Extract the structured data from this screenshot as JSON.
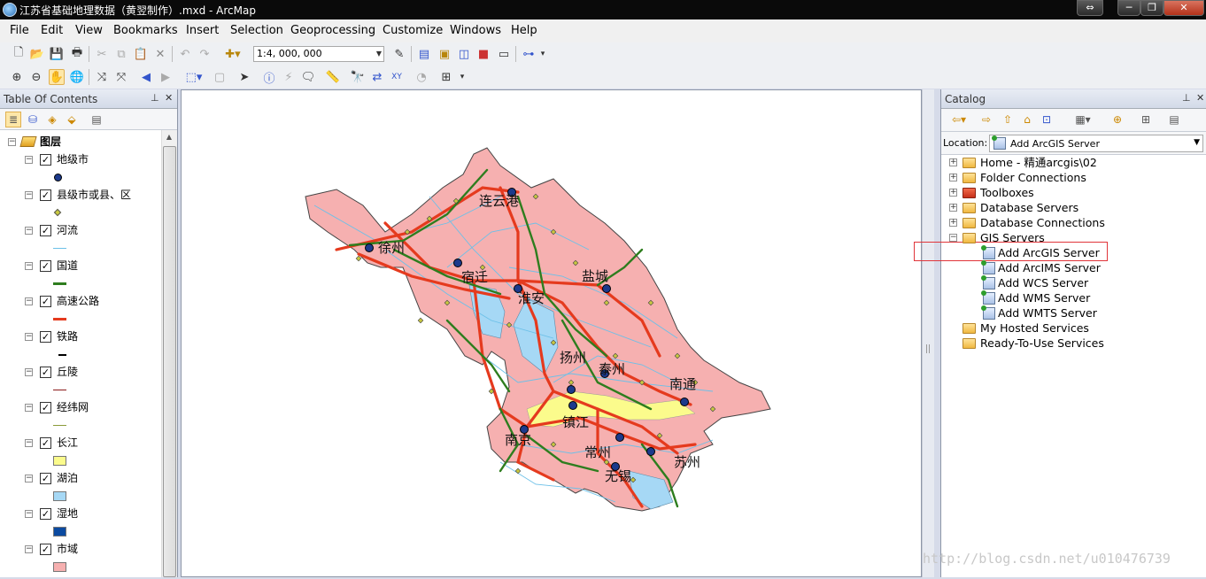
{
  "window": {
    "title": "江苏省基础地理数据（黄翌制作）.mxd - ArcMap",
    "controls": [
      "⇔",
      "─",
      "❐",
      "✕"
    ]
  },
  "menu": [
    "File",
    "Edit",
    "View",
    "Bookmarks",
    "Insert",
    "Selection",
    "Geoprocessing",
    "Customize",
    "Windows",
    "Help"
  ],
  "toolbar": {
    "scale": "1:4, 000, 000"
  },
  "toc": {
    "title": "Table Of Contents",
    "root": "图层",
    "layers": [
      {
        "name": "地级市",
        "symbol": "point-dark",
        "color": "#1c3a8c"
      },
      {
        "name": "县级市或县、区",
        "symbol": "point-small",
        "color": "#c8c840"
      },
      {
        "name": "河流",
        "symbol": "line",
        "color": "#6cc0e8"
      },
      {
        "name": "国道",
        "symbol": "line-thick",
        "color": "#2e7d1e"
      },
      {
        "name": "高速公路",
        "symbol": "line-thick",
        "color": "#e53a1e"
      },
      {
        "name": "铁路",
        "symbol": "rail",
        "color": "#000000"
      },
      {
        "name": "丘陵",
        "symbol": "line",
        "color": "#8b1a1a"
      },
      {
        "name": "经纬网",
        "symbol": "line",
        "color": "#8a9a3a"
      },
      {
        "name": "长江",
        "symbol": "fill",
        "color": "#fbfb8c"
      },
      {
        "name": "湖泊",
        "symbol": "fill",
        "color": "#a6d8f5"
      },
      {
        "name": "湿地",
        "symbol": "fill",
        "color": "#0b4aa0"
      },
      {
        "name": "市域",
        "symbol": "fill",
        "color": "#f6b0b0"
      }
    ]
  },
  "map": {
    "labels": [
      "连云港",
      "徐州",
      "宿迁",
      "淮安",
      "盐城",
      "扬州",
      "泰州",
      "南通",
      "镇江",
      "南京",
      "常州",
      "无锡",
      "苏州"
    ]
  },
  "catalog": {
    "title": "Catalog",
    "location_label": "Location:",
    "location_value": "Add ArcGIS Server",
    "tree": [
      {
        "label": "Home - 精通arcgis\\02",
        "level": 0,
        "expander": "+",
        "icon": "folder"
      },
      {
        "label": "Folder Connections",
        "level": 0,
        "expander": "+",
        "icon": "folder"
      },
      {
        "label": "Toolboxes",
        "level": 0,
        "expander": "+",
        "icon": "toolbox"
      },
      {
        "label": "Database Servers",
        "level": 0,
        "expander": "+",
        "icon": "db"
      },
      {
        "label": "Database Connections",
        "level": 0,
        "expander": "+",
        "icon": "db"
      },
      {
        "label": "GIS Servers",
        "level": 0,
        "expander": "−",
        "icon": "server"
      },
      {
        "label": "Add ArcGIS Server",
        "level": 1,
        "expander": "",
        "icon": "server-add"
      },
      {
        "label": "Add ArcIMS Server",
        "level": 1,
        "expander": "",
        "icon": "server-add"
      },
      {
        "label": "Add WCS Server",
        "level": 1,
        "expander": "",
        "icon": "server-add"
      },
      {
        "label": "Add WMS Server",
        "level": 1,
        "expander": "",
        "icon": "server-add"
      },
      {
        "label": "Add WMTS Server",
        "level": 1,
        "expander": "",
        "icon": "server-add"
      },
      {
        "label": "My Hosted Services",
        "level": 0,
        "expander": "",
        "icon": "folder"
      },
      {
        "label": "Ready-To-Use Services",
        "level": 0,
        "expander": "",
        "icon": "folder"
      }
    ]
  },
  "watermark": "http://blog.csdn.net/u010476739"
}
